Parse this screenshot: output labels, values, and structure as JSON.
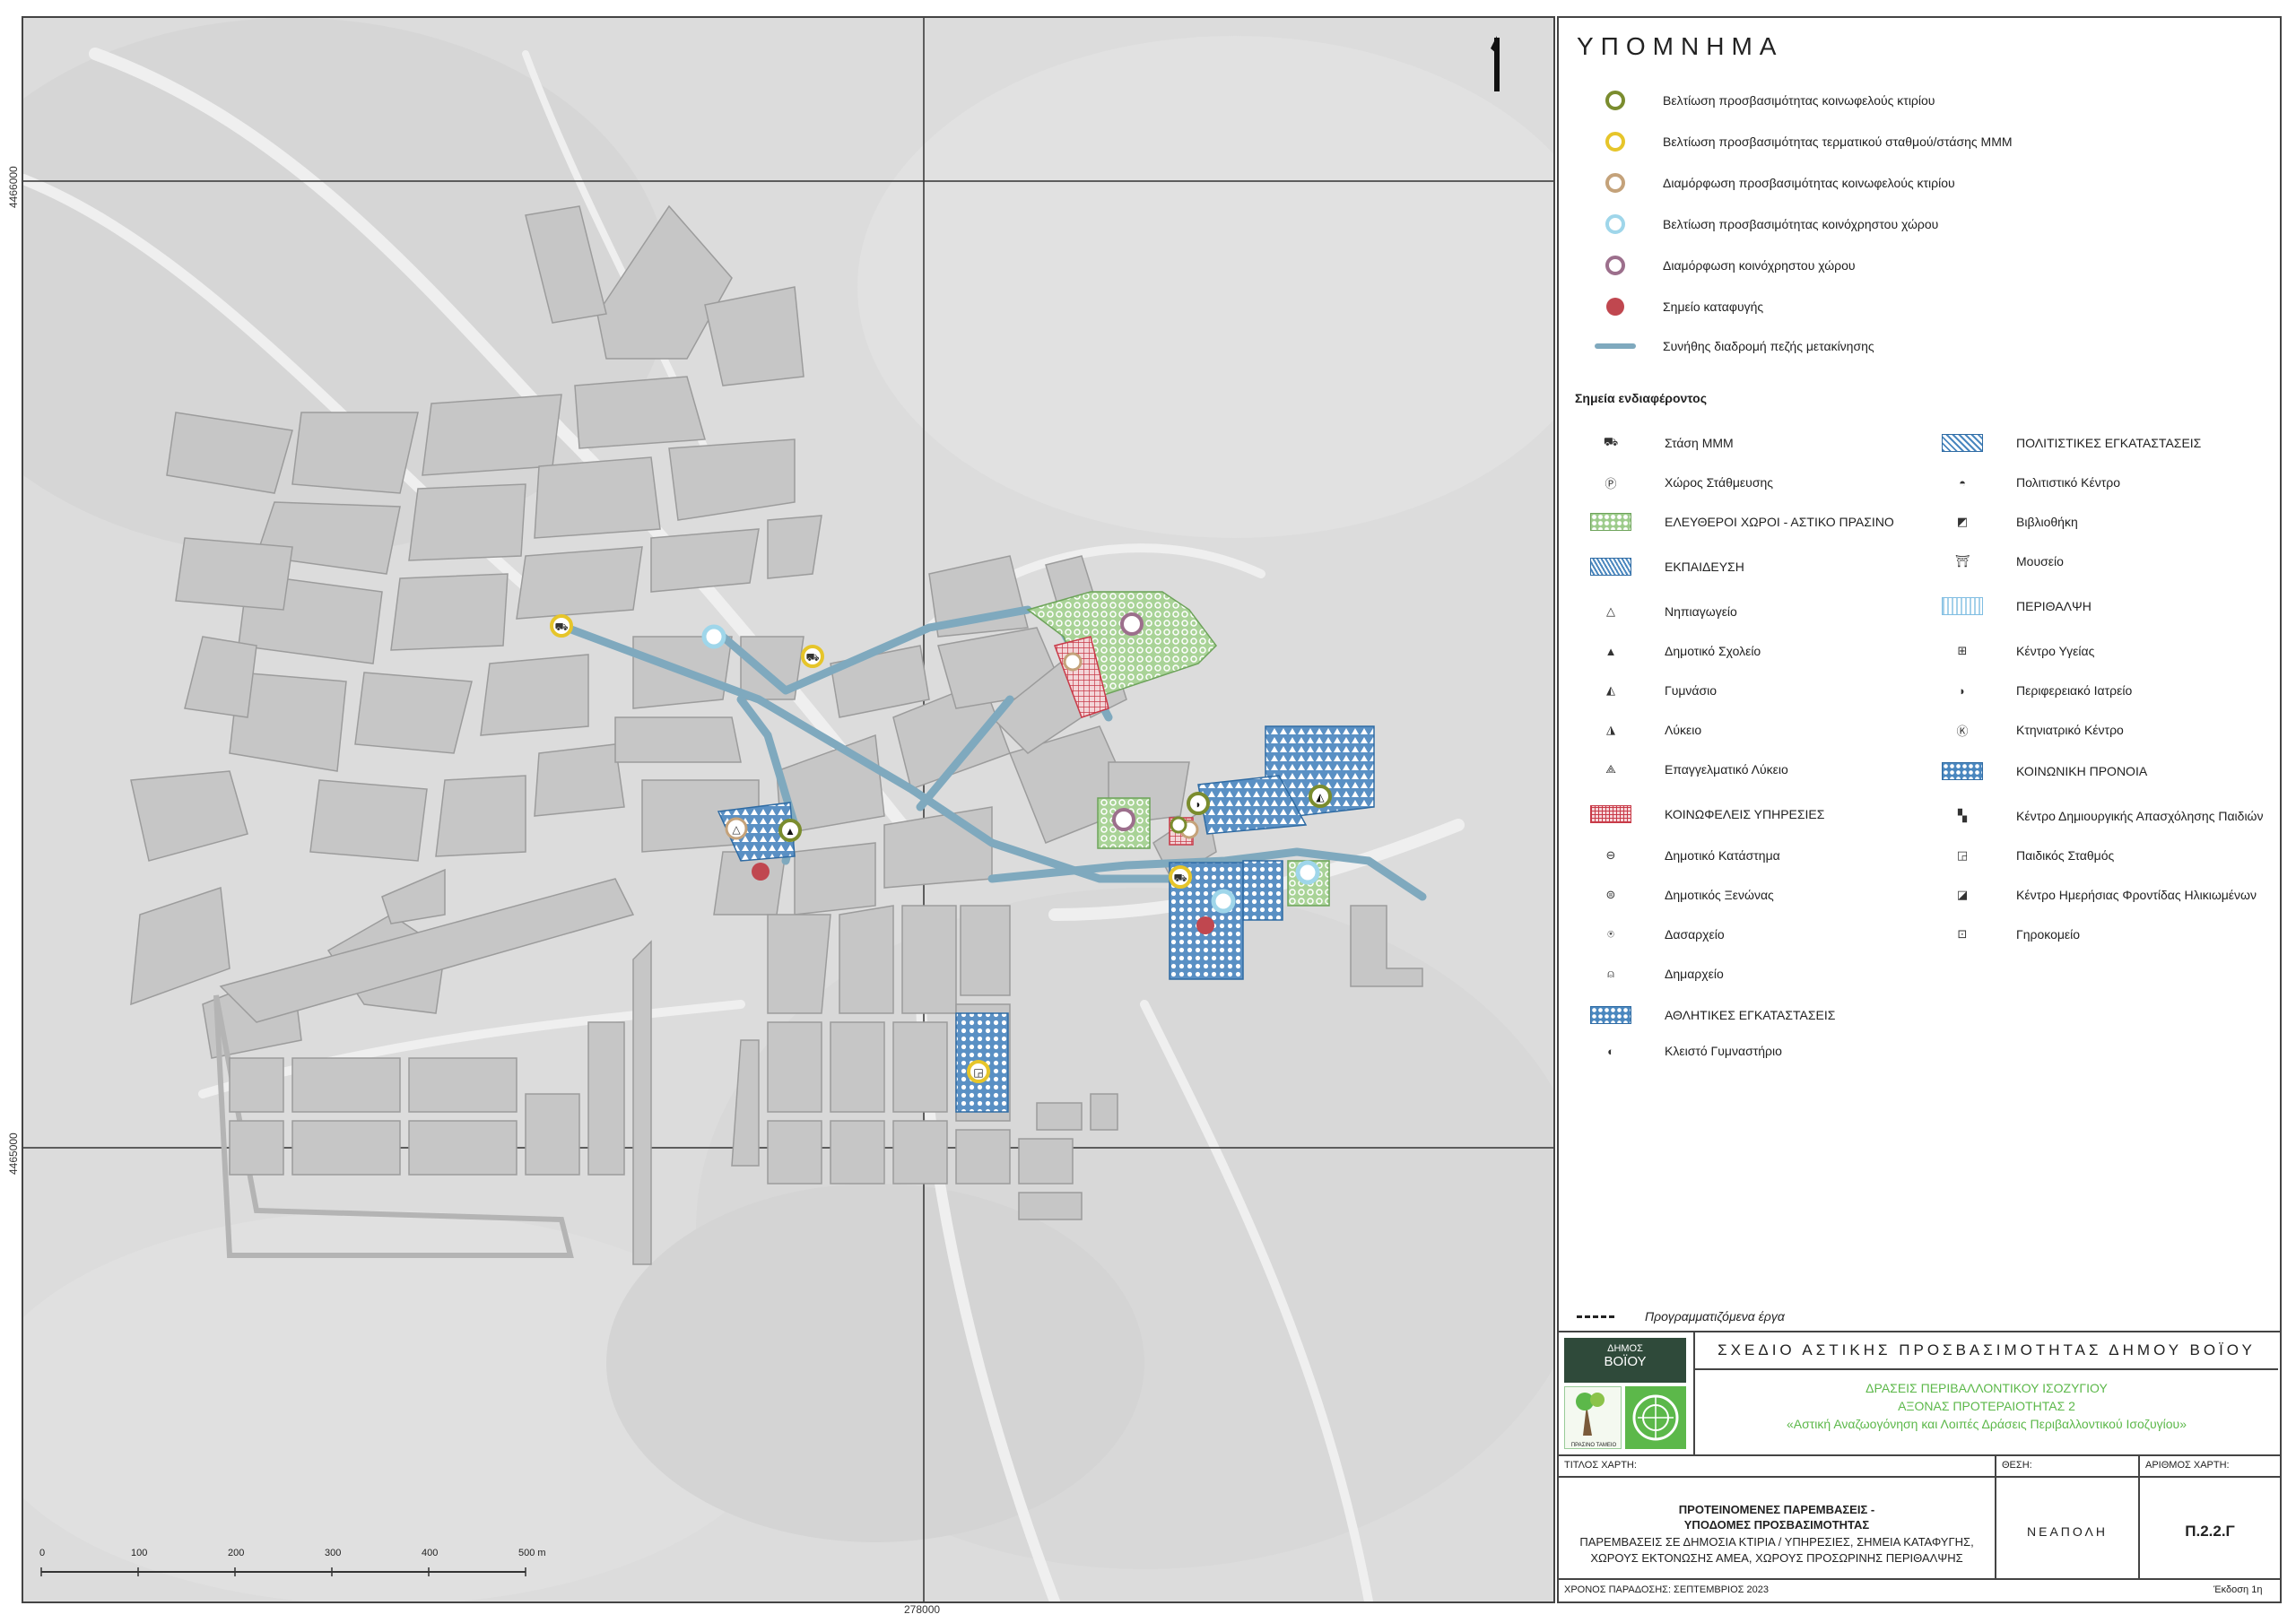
{
  "map": {
    "coords": {
      "y_top": "4466000",
      "y_bottom": "4465000",
      "x_bottom": "278000"
    },
    "scale": {
      "labels": [
        "0",
        "100",
        "200",
        "300",
        "400",
        "500 m"
      ]
    },
    "north_arrow_icon": "north-arrow-icon"
  },
  "legend": {
    "title": "ΥΠΟΜΝΗΜΑ",
    "main_items": [
      {
        "label": "Βελτίωση προσβασιμότητας κοινωφελούς κτιρίου",
        "symbol": "ring",
        "color": "#7a8c2e"
      },
      {
        "label": "Βελτίωση προσβασιμότητας τερματικού σταθμού/στάσης ΜΜΜ",
        "symbol": "ring",
        "color": "#e6c52a"
      },
      {
        "label": "Διαμόρφωση προσβασιμότητας κοινωφελούς κτιρίου",
        "symbol": "ring",
        "color": "#c4a27a"
      },
      {
        "label": "Βελτίωση προσβασιμότητας κοινόχρηστου χώρου",
        "symbol": "ring",
        "color": "#9fd6ea"
      },
      {
        "label": "Διαμόρφωση κοινόχρηστου χώρου",
        "symbol": "ring",
        "color": "#9c6f8c"
      },
      {
        "label": "Σημείο καταφυγής",
        "symbol": "dot",
        "color": "#c0474f"
      },
      {
        "label": "Συνήθης διαδρομή πεζής μετακίνησης",
        "symbol": "line",
        "color": "#7fa9be"
      }
    ],
    "poi_title": "Σημεία ενδιαφέροντος",
    "poi_left": [
      {
        "label": "Στάση ΜΜΜ",
        "icon": "bus-icon",
        "glyph": "⛟"
      },
      {
        "label": "Χώρος Στάθμευσης",
        "icon": "parking-icon",
        "glyph": "Ⓟ"
      },
      {
        "label": "ΕΛΕΥΘΕΡΟΙ ΧΩΡΟΙ - ΑΣΤΙΚΟ ΠΡΑΣΙΝΟ",
        "pattern": "green"
      },
      {
        "label": "ΕΚΠΑΙΔΕΥΣΗ",
        "pattern": "tri"
      },
      {
        "label": "Νηπιαγωγείο",
        "icon": "kindergarten-icon",
        "glyph": "△"
      },
      {
        "label": "Δημοτικό Σχολείο",
        "icon": "primary-school-icon",
        "glyph": "▲"
      },
      {
        "label": "Γυμνάσιο",
        "icon": "gymnasium-icon",
        "glyph": "◭"
      },
      {
        "label": "Λύκειο",
        "icon": "lyceum-icon",
        "glyph": "◮"
      },
      {
        "label": "Επαγγελματικό Λύκειο",
        "icon": "vocational-lyceum-icon",
        "glyph": "⟁"
      },
      {
        "label": "ΚΟΙΝΩΦΕΛΕΙΣ ΥΠΗΡΕΣΙΕΣ",
        "pattern": "red"
      },
      {
        "label": "Δημοτικό Κατάστημα",
        "icon": "municipal-store-icon",
        "glyph": "⊖"
      },
      {
        "label": "Δημοτικός Ξενώνας",
        "icon": "municipal-hostel-icon",
        "glyph": "⊜"
      },
      {
        "label": "Δασαρχείο",
        "icon": "forestry-office-icon",
        "glyph": "⍟"
      },
      {
        "label": "Δημαρχείο",
        "icon": "town-hall-icon",
        "glyph": "⍝"
      },
      {
        "label": "ΑΘΛΗΤΙΚΕΣ ΕΓΚΑΤΑΣΤΑΣΕΙΣ",
        "pattern": "dots"
      },
      {
        "label": "Κλειστό Γυμναστήριο",
        "icon": "indoor-gym-icon",
        "glyph": "◐"
      }
    ],
    "poi_right": [
      {
        "label": "ΠΟΛΙΤΙΣΤΙΚΕΣ ΕΓΚΑΤΑΣΤΑΣΕΙΣ",
        "pattern": "wave"
      },
      {
        "label": "Πολιτιστικό Κέντρο",
        "icon": "cultural-center-icon",
        "glyph": "◓"
      },
      {
        "label": "Βιβλιοθήκη",
        "icon": "library-icon",
        "glyph": "◩"
      },
      {
        "label": "Μουσείο",
        "icon": "museum-icon",
        "glyph": "⛩"
      },
      {
        "label": "ΠΕΡΙΘΑΛΨΗ",
        "pattern": "lightblue"
      },
      {
        "label": "Κέντρο Υγείας",
        "icon": "health-center-icon",
        "glyph": "⊞"
      },
      {
        "label": "Περιφερειακό Ιατρείο",
        "icon": "clinic-icon",
        "glyph": "◗"
      },
      {
        "label": "Κτηνιατρικό Κέντρο",
        "icon": "vet-center-icon",
        "glyph": "Ⓚ"
      },
      {
        "label": "ΚΟΙΝΩΝΙΚΗ ΠΡΟΝΟΙΑ",
        "pattern": "dots"
      },
      {
        "label": "Κέντρο Δημιουργικής Απασχόλησης Παιδιών",
        "icon": "children-center-icon",
        "glyph": "▚"
      },
      {
        "label": "Παιδικός Σταθμός",
        "icon": "nursery-icon",
        "glyph": "◲"
      },
      {
        "label": "Κέντρο Ημερήσιας Φροντίδας Ηλικιωμένων",
        "icon": "elderly-care-icon",
        "glyph": "◪"
      },
      {
        "label": "Γηροκομείο",
        "icon": "nursing-home-icon",
        "glyph": "⊡"
      }
    ],
    "planned_label": "Προγραμματιζόμενα έργα"
  },
  "title_block": {
    "logo_text_1": "ΔΗΜΟΣ",
    "logo_text_2": "ΒΟΪΟΥ",
    "logo_caption": "ΠΡΑΣΙΝΟ ΤΑΜΕΙΟ",
    "plan_title": "ΣΧΕΔΙΟ ΑΣΤΙΚΗΣ ΠΡΟΣΒΑΣΙΜΟΤΗΤΑΣ ΔΗΜΟΥ ΒΟΪΟΥ",
    "green_line_1": "ΔΡΑΣΕΙΣ ΠΕΡΙΒΑΛΛΟΝΤΙΚΟΥ ΙΣΟΖΥΓΙΟΥ",
    "green_line_2": "ΑΞΟΝΑΣ ΠΡΟΤΕΡΑΙΟΤΗΤΑΣ 2",
    "green_line_3": "«Αστική Αναζωογόνηση και Λοιπές Δράσεις Περιβαλλοντικού Ισοζυγίου»",
    "green_color": "#5cb84a",
    "label_map_title": "ΤΙΤΛΟΣ ΧΑΡΤΗ:",
    "label_position": "ΘΕΣΗ:",
    "label_map_number": "ΑΡΙΘΜΟΣ ΧΑΡΤΗ:",
    "map_title_1": "ΠΡΟΤΕΙΝΟΜΕΝΕΣ ΠΑΡΕΜΒΑΣΕΙΣ -",
    "map_title_2": "ΥΠΟΔΟΜΕΣ ΠΡΟΣΒΑΣΙΜΟΤΗΤΑΣ",
    "map_title_3": "ΠΑΡΕΜΒΑΣΕΙΣ ΣΕ ΔΗΜΟΣΙΑ ΚΤΙΡΙΑ / ΥΠΗΡΕΣΙΕΣ, ΣΗΜΕΙΑ ΚΑΤΑΦΥΓΗΣ,",
    "map_title_4": "ΧΩΡΟΥΣ ΕΚΤΟΝΩΣΗΣ ΑΜΕΑ, ΧΩΡΟΥΣ ΠΡΟΣΩΡΙΝΗΣ ΠΕΡΙΘΑΛΨΗΣ",
    "position_value": "ΝΕΑΠΟΛΗ",
    "map_number_value": "Π.2.2.Γ",
    "delivery_date": "ΧΡΟΝΟΣ ΠΑΡΑΔΟΣΗΣ: ΣΕΠΤΕΜΒΡΙΟΣ 2023",
    "edition": "Έκδοση 1η"
  }
}
